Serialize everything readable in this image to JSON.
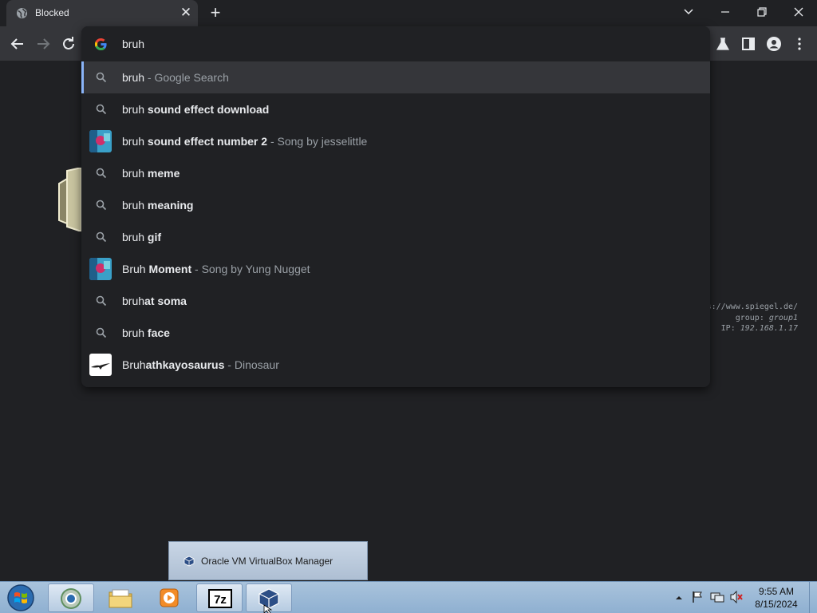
{
  "browser": {
    "tab": {
      "title": "Blocked",
      "favicon": "globe-icon",
      "close_glyph": "✕"
    },
    "new_tab_glyph": "+",
    "omnibox": {
      "value": "bruh",
      "suggestions": [
        {
          "kind": "search",
          "icon": "search-icon",
          "prefix": "bruh",
          "bold": "",
          "desc": " - Google Search",
          "selected": true
        },
        {
          "kind": "search",
          "icon": "search-icon",
          "prefix": "bruh",
          "bold": " sound effect download",
          "desc": ""
        },
        {
          "kind": "entity",
          "icon": "album-thumbnail",
          "prefix": "bruh",
          "bold": " sound effect number 2",
          "desc": " - Song by jesselittle"
        },
        {
          "kind": "search",
          "icon": "search-icon",
          "prefix": "bruh",
          "bold": " meme",
          "desc": ""
        },
        {
          "kind": "search",
          "icon": "search-icon",
          "prefix": "bruh",
          "bold": " meaning",
          "desc": ""
        },
        {
          "kind": "search",
          "icon": "search-icon",
          "prefix": "bruh",
          "bold": " gif",
          "desc": ""
        },
        {
          "kind": "entity",
          "icon": "album-thumbnail",
          "prefix": "Bruh",
          "bold": " Moment",
          "desc": " - Song by Yung Nugget"
        },
        {
          "kind": "search",
          "icon": "search-icon",
          "prefix": "bruh",
          "bold": "at soma",
          "desc": ""
        },
        {
          "kind": "search",
          "icon": "search-icon",
          "prefix": "bruh",
          "bold": " face",
          "desc": ""
        },
        {
          "kind": "entity",
          "icon": "dinosaur-thumbnail",
          "prefix": "Bruh",
          "bold": "athkayosaurus",
          "desc": " - Dinosaur"
        }
      ]
    }
  },
  "page": {
    "info_line1": "s://www.spiegel.de/",
    "info_line2_label": "group: ",
    "info_line2_value": "group1",
    "info_line3_label": "IP: ",
    "info_line3_value": "192.168.1.17"
  },
  "taskbar": {
    "preview_label": "Oracle VM VirtualBox Manager",
    "time": "9:55 AM",
    "date": "8/15/2024",
    "apps": [
      "chrome-icon",
      "explorer-icon",
      "media-player-icon",
      "7zip-icon",
      "virtualbox-icon"
    ]
  },
  "colors": {
    "accent": "#8ab4f8",
    "popup_bg": "#202124",
    "toolbar_bg": "#35363a"
  }
}
